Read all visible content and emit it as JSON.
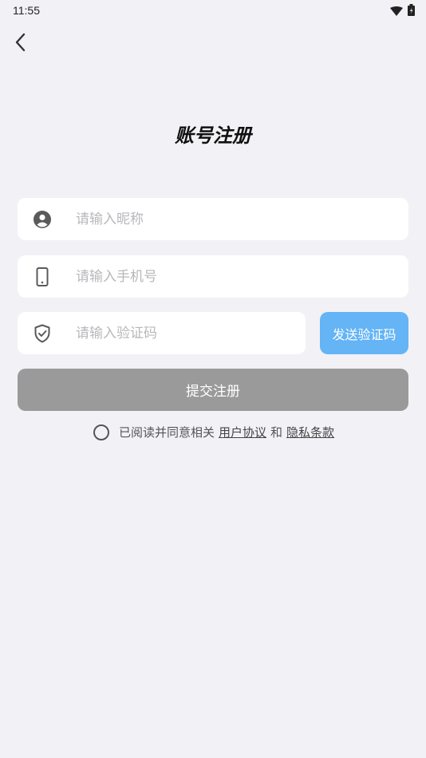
{
  "status_bar": {
    "time": "11:55",
    "icons": [
      "wifi-icon",
      "battery-icon"
    ]
  },
  "header": {
    "back_icon": "chevron-left-icon",
    "title": "账号注册"
  },
  "form": {
    "nickname": {
      "icon": "user-icon",
      "placeholder": "请输入昵称",
      "value": ""
    },
    "phone": {
      "icon": "phone-icon",
      "placeholder": "请输入手机号",
      "value": ""
    },
    "code": {
      "icon": "shield-check-icon",
      "placeholder": "请输入验证码",
      "value": ""
    },
    "send_code_label": "发送验证码",
    "submit_label": "提交注册"
  },
  "agreement": {
    "checked": false,
    "prefix": "已阅读并同意相关",
    "user_agreement": "用户协议",
    "connector": "和",
    "privacy_policy": "隐私条款"
  },
  "colors": {
    "background": "#f2f1f6",
    "send_code_button": "#64b4f6",
    "submit_button": "#9a9a9a"
  }
}
